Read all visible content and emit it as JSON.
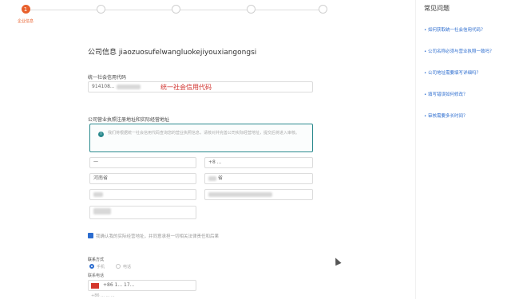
{
  "stepper": {
    "steps": [
      {
        "num": "1",
        "label": "企业信息"
      },
      {
        "num": "2",
        "label": ""
      },
      {
        "num": "3",
        "label": ""
      },
      {
        "num": "4",
        "label": ""
      },
      {
        "num": "5",
        "label": ""
      }
    ]
  },
  "company_info": {
    "title": "公司信息 jiaozuosufelwangluokejiyouxiangongsi",
    "credit_code_label": "统一社会信用代码",
    "credit_code_value": "914108...",
    "annotation": "统一社会信用代码"
  },
  "address": {
    "label": "公司营业执照注册地址和实际经营地址",
    "notice": "我们将根据统一社会信用代码查询您的营业执照信息，请核对并完善公司实际经营地址，提交后将进入审核。",
    "fields": [
      "一",
      "+8 ...",
      "河南省",
      "省",
      "",
      "",
      ""
    ]
  },
  "agreement": {
    "text": "我确认我的实际经营地址，并同意承担一切相关法律责任和后果"
  },
  "contact": {
    "label": "联系方式",
    "option1": "手机",
    "option2": "电话",
    "phone_label": "联系电话",
    "phone_value": "+86 1...  17...",
    "footer": "+86  ...  ...  ..."
  },
  "sidebar": {
    "title": "常见问题",
    "items": [
      "• 如何获取统一社会信用代码？",
      "• 公司名称必须与营业执照一致吗？",
      "• 公司地址需要填写详细吗？",
      "• 填写错误如何修改？",
      "• 审核需要多长时间？"
    ]
  },
  "colors": {
    "accent": "#e8602c",
    "teal": "#2b8a8e",
    "link": "#2b6ccf",
    "annotation": "#d0312d"
  }
}
